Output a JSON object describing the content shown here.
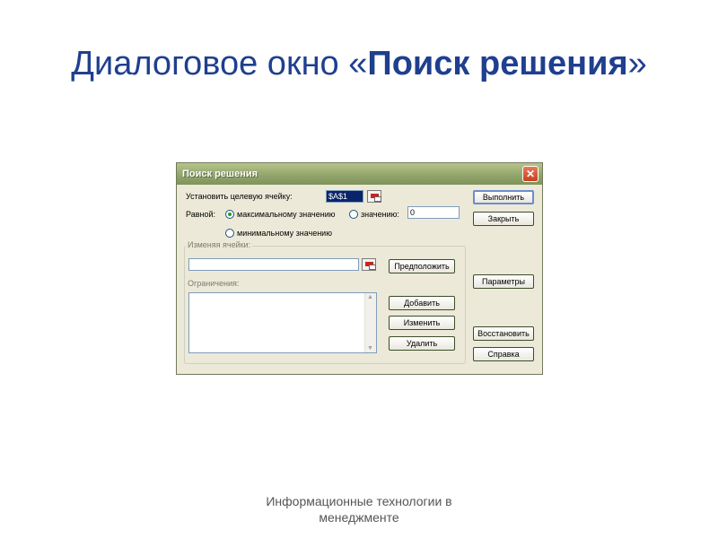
{
  "slide": {
    "title_prefix": "Диалоговое окно «",
    "title_bold": "Поиск решения",
    "title_suffix": "»",
    "footer_line1": "Информационные технологии в",
    "footer_line2": "менеджменте"
  },
  "dialog": {
    "title": "Поиск решения",
    "target_cell_label": "Установить целевую ячейку:",
    "target_cell_value": "$A$1",
    "equal_label": "Равной:",
    "radio_max": "максимальному значению",
    "radio_value": "значению:",
    "value_field": "0",
    "radio_min": "минимальному значению",
    "changing_cells_label": "Изменяя ячейки:",
    "changing_cells_value": "",
    "guess_button": "Предположить",
    "constraints_label": "Ограничения:",
    "add_button": "Добавить",
    "change_button": "Изменить",
    "delete_button": "Удалить",
    "solve_button": "Выполнить",
    "close_button": "Закрыть",
    "options_button": "Параметры",
    "reset_button": "Восстановить",
    "help_button": "Справка",
    "selected_radio": "max"
  },
  "colors": {
    "title_blue": "#1f3f8f",
    "dialog_bg": "#ece9d8",
    "titlebar_olive": "#8fa36a"
  }
}
